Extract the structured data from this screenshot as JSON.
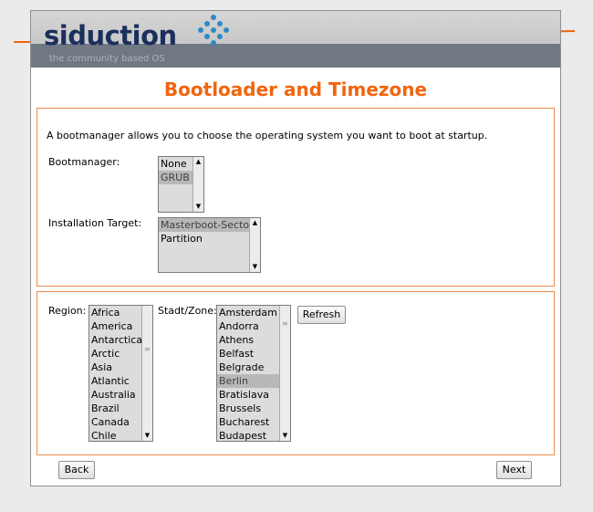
{
  "header": {
    "brand": "siduction",
    "tagline": "the community based OS",
    "accent_color": "#f0650e",
    "brand_color": "#1b2f5c"
  },
  "page_title": "Bootloader and Timezone",
  "bootloader": {
    "intro": "A bootmanager allows you to choose the operating system you want to boot at startup.",
    "bootmanager_label": "Bootmanager:",
    "bootmanager_options": [
      "None",
      "GRUB"
    ],
    "bootmanager_selected": "GRUB",
    "target_label": "Installation Target:",
    "target_options": [
      "Masterboot-Sector",
      "Partition"
    ],
    "target_selected": "Masterboot-Sector"
  },
  "timezone": {
    "region_label": "Region:",
    "regions": [
      "Africa",
      "America",
      "Antarctica",
      "Arctic",
      "Asia",
      "Atlantic",
      "Australia",
      "Brazil",
      "Canada",
      "Chile"
    ],
    "zone_label": "Stadt/Zone:",
    "zones": [
      "Amsterdam",
      "Andorra",
      "Athens",
      "Belfast",
      "Belgrade",
      "Berlin",
      "Bratislava",
      "Brussels",
      "Bucharest",
      "Budapest"
    ],
    "zone_selected": "Berlin",
    "refresh_label": "Refresh"
  },
  "nav": {
    "back_label": "Back",
    "next_label": "Next"
  }
}
